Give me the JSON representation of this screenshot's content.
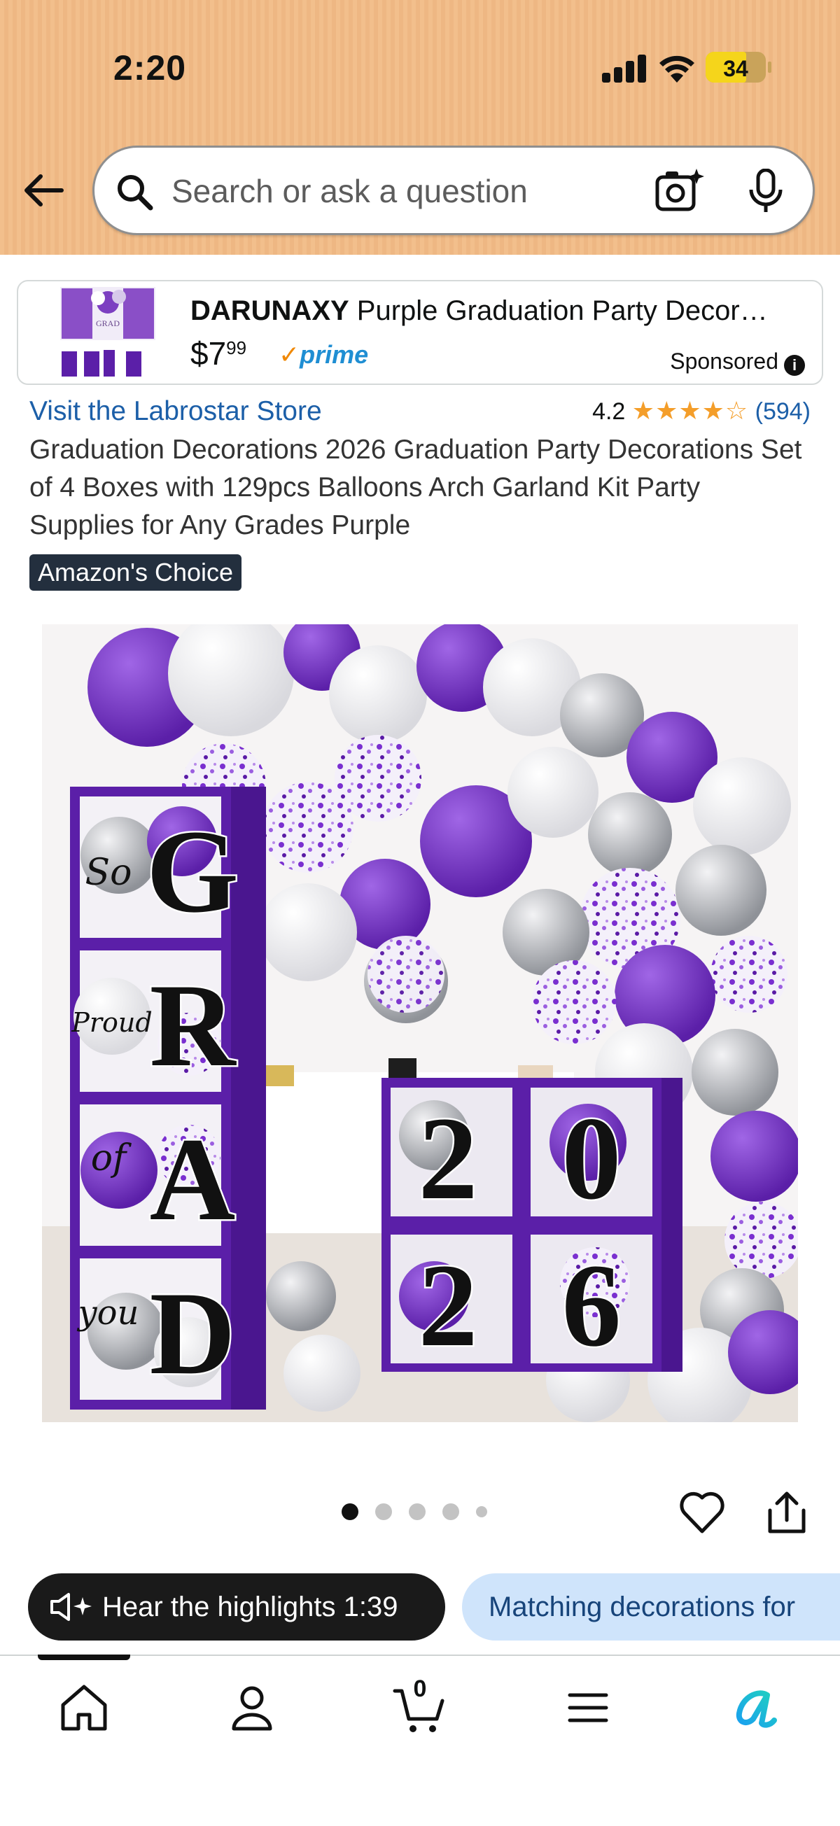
{
  "status_bar": {
    "time": "2:20",
    "battery": "34"
  },
  "search": {
    "placeholder": "Search or ask a question"
  },
  "sponsored_ad": {
    "brand": "DARUNAXY",
    "title_rest": " Purple Graduation Party Decor…",
    "price_dollars": "$7",
    "price_cents": "99",
    "prime_label": "prime",
    "sponsored_label": "Sponsored",
    "thumb_text": "GRAD"
  },
  "product": {
    "store_link": "Visit the Labrostar Store",
    "rating_value": "4.2",
    "rating_stars": "★★★★☆",
    "rating_count": "(594)",
    "title": "Graduation Decorations 2026 Graduation Party Decorations Set of 4 Boxes with 129pcs Balloons Arch Garland Kit Party Supplies for Any Grades Purple",
    "badge": "Amazon's Choice",
    "image": {
      "box_letters": [
        "G",
        "R",
        "A",
        "D"
      ],
      "side_words": [
        "So",
        "Proud",
        "of",
        "you"
      ],
      "number_boxes": [
        "2",
        "0",
        "2",
        "6"
      ]
    },
    "carousel_count": 5,
    "carousel_active": 0
  },
  "chips": {
    "audio": "Hear the highlights 1:39",
    "match": "Matching decorations for"
  },
  "nav": {
    "items": [
      "home-icon",
      "account-icon",
      "cart-icon",
      "menu-icon",
      "rufus-icon"
    ],
    "cart_count": "0"
  },
  "colors": {
    "header_bg": "#f2bf8c",
    "link": "#1c5fa8",
    "purple": "#5b1fa8",
    "badge_bg": "#232f3e",
    "chip_light": "#cfe4fb"
  }
}
